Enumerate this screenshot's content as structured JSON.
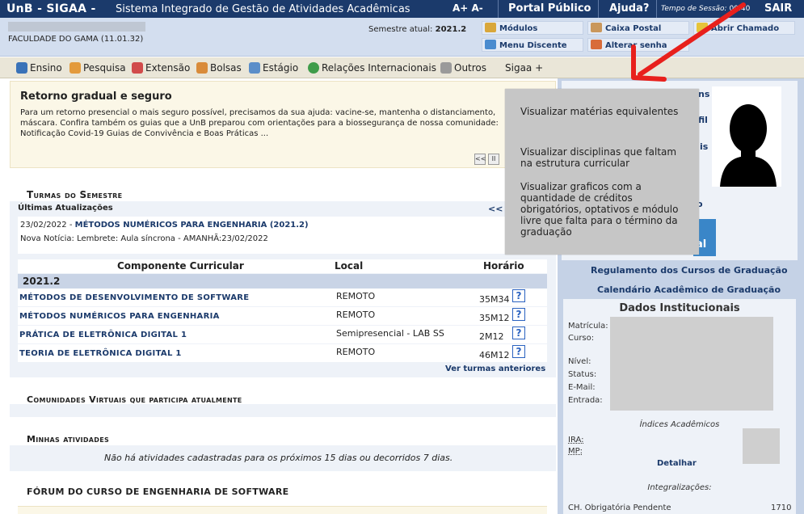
{
  "topbar": {
    "brand": "UnB - SIGAA -",
    "system_name": "Sistema Integrado de Gestão de Atividades Acadêmicas",
    "font_controls": "A+ A-",
    "portal": "Portal Público",
    "ajuda": "Ajuda?",
    "tempo_label": "Tempo de Sessão:",
    "tempo_value": "00:40",
    "sair": "SAIR"
  },
  "infobar": {
    "faculdade": "FACULDADE DO GAMA (11.01.32)",
    "semestre_label": "Semestre atual:",
    "semestre_value": "2021.2",
    "buttons": {
      "modulos": "Módulos",
      "caixa_postal": "Caixa Postal",
      "abrir_chamado": "Abrir Chamado",
      "menu_discente": "Menu Discente",
      "alterar_senha": "Alterar senha"
    }
  },
  "menu": {
    "ensino": "Ensino",
    "pesquisa": "Pesquisa",
    "extensao": "Extensão",
    "bolsas": "Bolsas",
    "estagio": "Estágio",
    "relacoes": "Relações Internacionais",
    "outros": "Outros",
    "sigaa_plus": "Sigaa +"
  },
  "news": {
    "title": "Retorno gradual e seguro",
    "text": "Para um retorno presencial o mais seguro possível, precisamos da sua ajuda: vacine-se, mantenha o distanciamento, máscara. Confira também os guias que a UnB preparou com orientações para a biossegurança de nossa comunidade: Notificação Covid-19 Guias de Convivência e Boas Práticas ...",
    "prev": "<<",
    "pause": "II"
  },
  "turmas": {
    "section_title": "Turmas do Semestre",
    "ultimas_label": "Últimas Atualizações",
    "ultimas_nav": "<<",
    "update_date": "23/02/2022 -",
    "update_course": "MÉTODOS NUMÉRICOS PARA ENGENHARIA (2021.2)",
    "update_note": "Nova Notícia: Lembrete: Aula síncrona - AMANHÃ:23/02/2022",
    "headers": {
      "componente": "Componente Curricular",
      "local": "Local",
      "horario": "Horário"
    },
    "semester": "2021.2",
    "rows": [
      {
        "name": "MÉTODOS DE DESENVOLVIMENTO DE SOFTWARE",
        "local": "REMOTO",
        "horario": "35M34",
        "help": "?"
      },
      {
        "name": "MÉTODOS NUMÉRICOS PARA ENGENHARIA",
        "local": "REMOTO",
        "horario": "35M12",
        "help": "?"
      },
      {
        "name": "PRÁTICA DE ELETRÔNICA DIGITAL 1",
        "local": "Semipresencial - LAB SS",
        "horario": "2M12",
        "help": "?"
      },
      {
        "name": "TEORIA DE ELETRÔNICA DIGITAL 1",
        "local": "REMOTO",
        "horario": "46M12",
        "help": "?"
      }
    ],
    "ver_anteriores": "Ver turmas anteriores"
  },
  "comunidades": {
    "title": "Comunidades Virtuais que participa atualmente"
  },
  "minhas": {
    "title": "Minhas atividades",
    "empty": "Não há atividades cadastradas para os próximos 15 dias ou decorridos 7 dias."
  },
  "forum": {
    "title": "FÓRUM DO CURSO DE ENGENHARIA DE SOFTWARE"
  },
  "right": {
    "link1_tail": "ns",
    "link2_tail": "fil",
    "link3_tail": "is",
    "link4_tail": "o",
    "badge_text": "al",
    "regulamento": "Regulamento dos Cursos de Graduação",
    "calendario": "Calendário Acadêmico de Graduação",
    "dados_title": "Dados Institucionais",
    "labels": {
      "matricula": "Matrícula:",
      "curso": "Curso:",
      "nivel": "Nível:",
      "status": "Status:",
      "email": "E-Mail:",
      "entrada": "Entrada:",
      "ira": "IRA:",
      "mp": "MP:"
    },
    "indices": "Índices Acadêmicos",
    "detalhar": "Detalhar",
    "integralizacoes": "Integralizações:",
    "ch_obrigatoria_label": "CH. Obrigatória Pendente",
    "ch_obrigatoria_value": "1710"
  },
  "tooltip": {
    "item1": "Visualizar matérias equivalentes",
    "item2": "Visualizar disciplinas que faltam na estrutura curricular",
    "item3": "Visualizar graficos com a quantidade  de créditos obrigatórios, optativos e  módulo livre que falta para o término da graduação"
  },
  "colors": {
    "topbar": "#1b3a6b",
    "infobar": "#d3deef",
    "menubar": "#eae6d8",
    "link": "#1b3a6b",
    "arrow": "#e8201c",
    "tooltip": "#c6c6c6"
  }
}
